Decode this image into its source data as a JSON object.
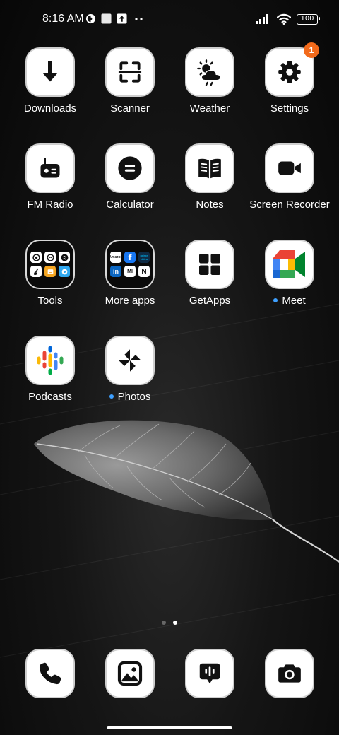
{
  "status_bar": {
    "time": "8:16 AM",
    "battery": "100",
    "icons": [
      "data-saver-icon",
      "image-notification-icon",
      "upload-notification-icon",
      "more-notifications-icon",
      "signal-icon",
      "wifi-icon",
      "battery-icon"
    ]
  },
  "apps": [
    {
      "label": "Downloads",
      "icon": "download-arrow-icon"
    },
    {
      "label": "Scanner",
      "icon": "scanner-icon"
    },
    {
      "label": "Weather",
      "icon": "weather-icon"
    },
    {
      "label": "Settings",
      "icon": "gear-icon",
      "badge": "1"
    },
    {
      "label": "FM Radio",
      "icon": "radio-icon"
    },
    {
      "label": "Calculator",
      "icon": "calculator-icon"
    },
    {
      "label": "Notes",
      "icon": "book-icon"
    },
    {
      "label": "Screen Recorder",
      "icon": "video-camera-icon"
    },
    {
      "label": "Tools",
      "icon": "folder-icon",
      "folder_apps": [
        "compass-icon",
        "clock-icon",
        "shazam-icon",
        "cleaner-icon",
        "file-manager-icon",
        "mi-remote-icon"
      ]
    },
    {
      "label": "More apps",
      "icon": "folder-icon",
      "folder_apps": [
        "Amazon",
        "f",
        "prime video",
        "in",
        "MI",
        "N"
      ]
    },
    {
      "label": "GetApps",
      "icon": "grid-icon"
    },
    {
      "label": "Meet",
      "icon": "google-meet-icon",
      "new": true
    },
    {
      "label": "Podcasts",
      "icon": "google-podcasts-icon"
    },
    {
      "label": "Photos",
      "icon": "pinwheel-icon",
      "new": true
    }
  ],
  "page_indicator": {
    "count": 2,
    "active": 1
  },
  "dock": [
    {
      "name": "phone",
      "icon": "phone-icon"
    },
    {
      "name": "gallery",
      "icon": "gallery-icon"
    },
    {
      "name": "messages",
      "icon": "message-icon"
    },
    {
      "name": "camera",
      "icon": "camera-icon"
    }
  ],
  "colors": {
    "badge": "#f26a1b",
    "new_dot": "#3ea0ff",
    "icon_bg": "#ffffff",
    "glyph": "#111111"
  }
}
